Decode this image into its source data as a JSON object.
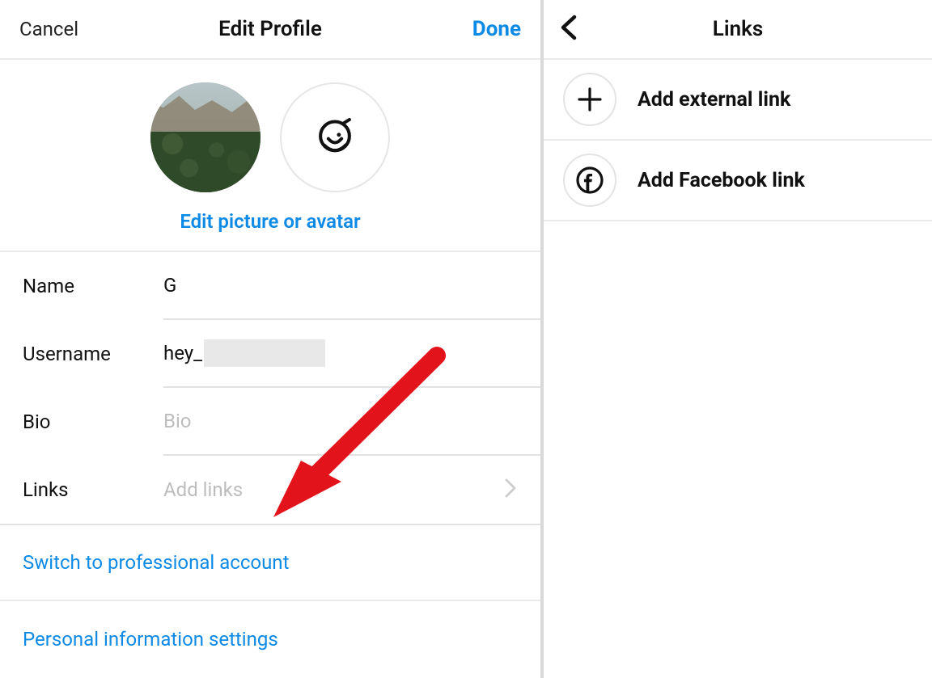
{
  "left": {
    "header": {
      "cancel": "Cancel",
      "title": "Edit Profile",
      "done": "Done"
    },
    "avatar": {
      "edit_label": "Edit picture or avatar"
    },
    "fields": {
      "name": {
        "label": "Name",
        "value": "G"
      },
      "username": {
        "label": "Username",
        "prefix": "hey_"
      },
      "bio": {
        "label": "Bio",
        "placeholder": "Bio"
      },
      "links": {
        "label": "Links",
        "placeholder": "Add links"
      }
    },
    "actions": {
      "switch_professional": "Switch to professional account",
      "personal_info": "Personal information settings"
    }
  },
  "right": {
    "title": "Links",
    "items": {
      "external": "Add external link",
      "facebook": "Add Facebook link"
    }
  },
  "colors": {
    "accent": "#0d8ae6",
    "annotation": "#e3131b"
  }
}
